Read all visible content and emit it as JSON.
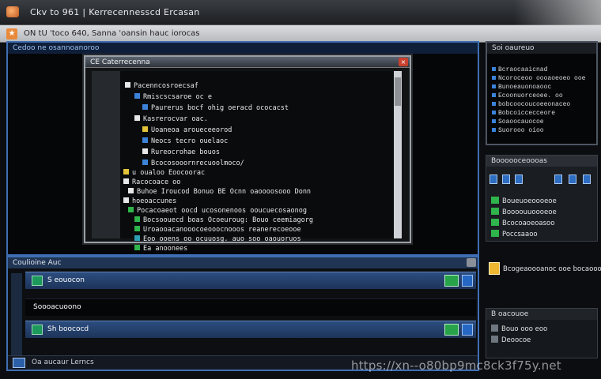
{
  "window": {
    "title": "Ckv to 961 | Kerrecennesscd Ercasan"
  },
  "toolbar": {
    "text": "ON tU 'toco 640, Sanna 'oansin  hauc iorocas"
  },
  "main_panel": {
    "header": "Cedoo ne osannoanoroo",
    "border_color": "#3f6fb3"
  },
  "console": {
    "title": "CE Caterrecenna",
    "rows": [
      {
        "bullet": "white",
        "text": "Pacenncosroecsaf"
      },
      {
        "bullet": "blue",
        "text": "Rmiscscsaroe oc e"
      },
      {
        "bullet": "blue",
        "text": "Paurerus bocf ohig oeracd ococacst"
      },
      {
        "bullet": "white",
        "text": "Kasrerocvar oac."
      },
      {
        "bullet": "yellow",
        "text": "Uoaneoa aroueceeorod"
      },
      {
        "bullet": "blue",
        "text": "Neocs tecro ouelaoc"
      },
      {
        "bullet": "white",
        "text": "Rureocrohae bouos"
      },
      {
        "bullet": "blue",
        "text": "Bcocosooornrecuoolmoco/"
      },
      {
        "bullet": "yellow",
        "text": "u oualoo Eoocoorac"
      },
      {
        "bullet": "white",
        "text": "Racocoace oo"
      },
      {
        "bullet": "white",
        "text": "Buhoe Iroucod Bonuo BE Ocnn oaoooosooo Donn"
      },
      {
        "bullet": "white",
        "text": "hoeoaccunes"
      },
      {
        "bullet": "green",
        "text": "Pocacoaeot oocd ucosonenoos ooucuecosaonog"
      },
      {
        "bullet": "green",
        "text": "Bocsoouecd boas Ocoeuroug: Bouo ceemiagorg"
      },
      {
        "bullet": "green",
        "text": "Uroaooacanooocoeooocnooos reanerecoeooe"
      },
      {
        "bullet": "teal",
        "text": "Eoo ooens oo ocuuosg.  auo soo oaouoruos"
      },
      {
        "bullet": "green",
        "text": "Ea anoonees"
      }
    ]
  },
  "bottom_panel": {
    "header": "Coulioine Auc",
    "rows": [
      {
        "label": "S eouocon"
      },
      {
        "label": "Soooacuoono"
      },
      {
        "label": "Sh boococd"
      }
    ],
    "footer": "Oa aucaur Lerncs"
  },
  "right_top": {
    "header": "Soi oaureuo",
    "lines": [
      "Bcraocaaicnad",
      "Ncoroceoo  oooaoeoeo ooe",
      "Bunoeauonoaooc",
      "Ecoonuorceoee. oo",
      "bobcoocoucoeeonaceo",
      "Bobcoiccecceore",
      "Soaoocauocoe",
      "Suorooo  oioo"
    ]
  },
  "right_mid": {
    "header": "Boooooceoooas",
    "items": [
      "Boueuoeoooeoe",
      "Boooouuoooeoe",
      "Bcocoaoeoasoo",
      "Poccsaaoo"
    ]
  },
  "right_note": {
    "text": "Bcogeaoooanoc ooe  bocaooo oue"
  },
  "right_bottom": {
    "header": "B oacouoe",
    "rows": [
      "Bouo ooo eoo",
      "Deoocoe"
    ]
  },
  "watermark": "https://xn--o80bp9mc8ck3f75y.net"
}
